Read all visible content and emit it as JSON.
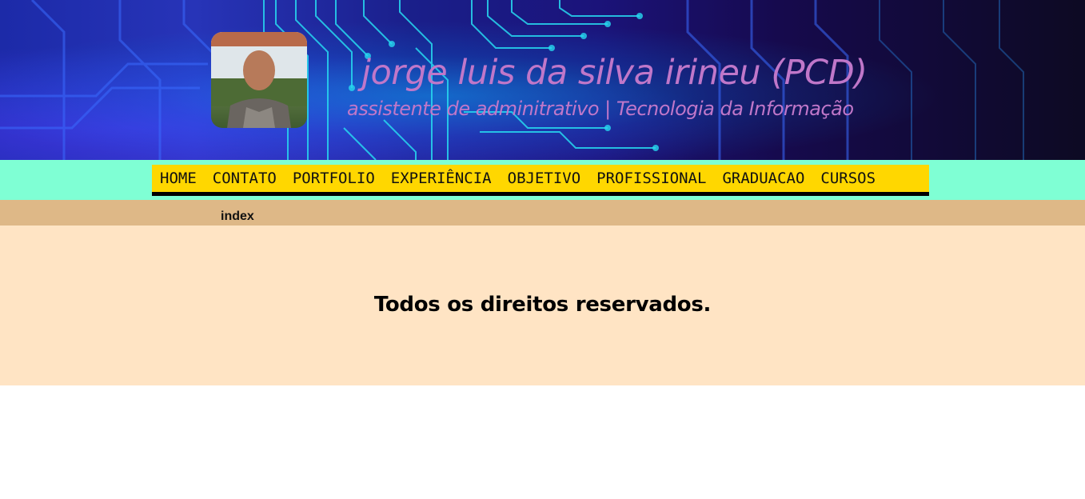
{
  "header": {
    "name": "jorge luis da silva irineu (PCD)",
    "subtitle": "assistente de adminitrativo | Tecnologia da Informação"
  },
  "nav": {
    "items": [
      {
        "label": "HOME"
      },
      {
        "label": "CONTATO"
      },
      {
        "label": "PORTFOLIO"
      },
      {
        "label": "EXPERIÊNCIA"
      },
      {
        "label": "OBJETIVO"
      },
      {
        "label": "PROFISSIONAL"
      },
      {
        "label": "GRADUACAO"
      },
      {
        "label": "CURSOS"
      }
    ]
  },
  "breadcrumb": {
    "current": "index"
  },
  "footer": {
    "text": "Todos os direitos reservados."
  },
  "colors": {
    "nav_strip": "#7fffd4",
    "nav_bar": "#ffd700",
    "crumb_strip": "#deb887",
    "footer": "#ffe4c4",
    "banner_text": "#c077c9"
  }
}
